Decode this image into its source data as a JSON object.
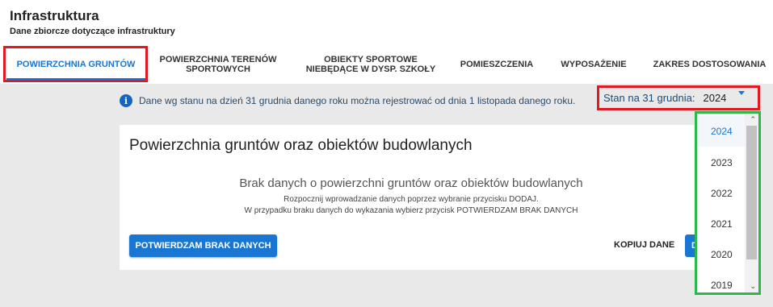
{
  "header": {
    "title": "Infrastruktura",
    "subtitle": "Dane zbiorcze dotyczące infrastruktury"
  },
  "tabs": [
    {
      "label": "POWIERZCHNIA GRUNTÓW",
      "active": true
    },
    {
      "label": "POWIERZCHNIA TERENÓW SPORTOWYCH",
      "active": false
    },
    {
      "label": "OBIEKTY SPORTOWE NIEBĘDĄCE W DYSP. SZKOŁY",
      "active": false
    },
    {
      "label": "POMIESZCZENIA",
      "active": false
    },
    {
      "label": "WYPOSAŻENIE",
      "active": false
    },
    {
      "label": "ZAKRES DOSTOSOWANIA",
      "active": false
    }
  ],
  "info": {
    "icon": "info-icon",
    "text": "Dane wg stanu na dzień 31 grudnia danego roku można rejestrować od dnia 1 listopada danego roku."
  },
  "stan": {
    "label": "Stan na 31 grudnia:",
    "value": "2024"
  },
  "card": {
    "title": "Powierzchnia gruntów oraz obiektów budowlanych",
    "empty_title": "Brak danych o powierzchni gruntów oraz obiektów budowlanych",
    "empty_line1": "Rozpocznij wprowadzanie danych poprzez wybranie przycisku DODAJ.",
    "empty_line2": "W przypadku braku danych do wykazania wybierz przycisk POTWIERDZAM BRAK DANYCH",
    "confirm_button": "POTWIERDZAM BRAK DANYCH",
    "copy_button": "KOPIUJ DANE",
    "add_button_partial": "D"
  },
  "dropdown": {
    "options": [
      "2024",
      "2023",
      "2022",
      "2021",
      "2020",
      "2019"
    ],
    "selected": "2024"
  },
  "colors": {
    "accent": "#1976d2",
    "highlight_red": "#e01a22",
    "highlight_green": "#2db84d"
  }
}
